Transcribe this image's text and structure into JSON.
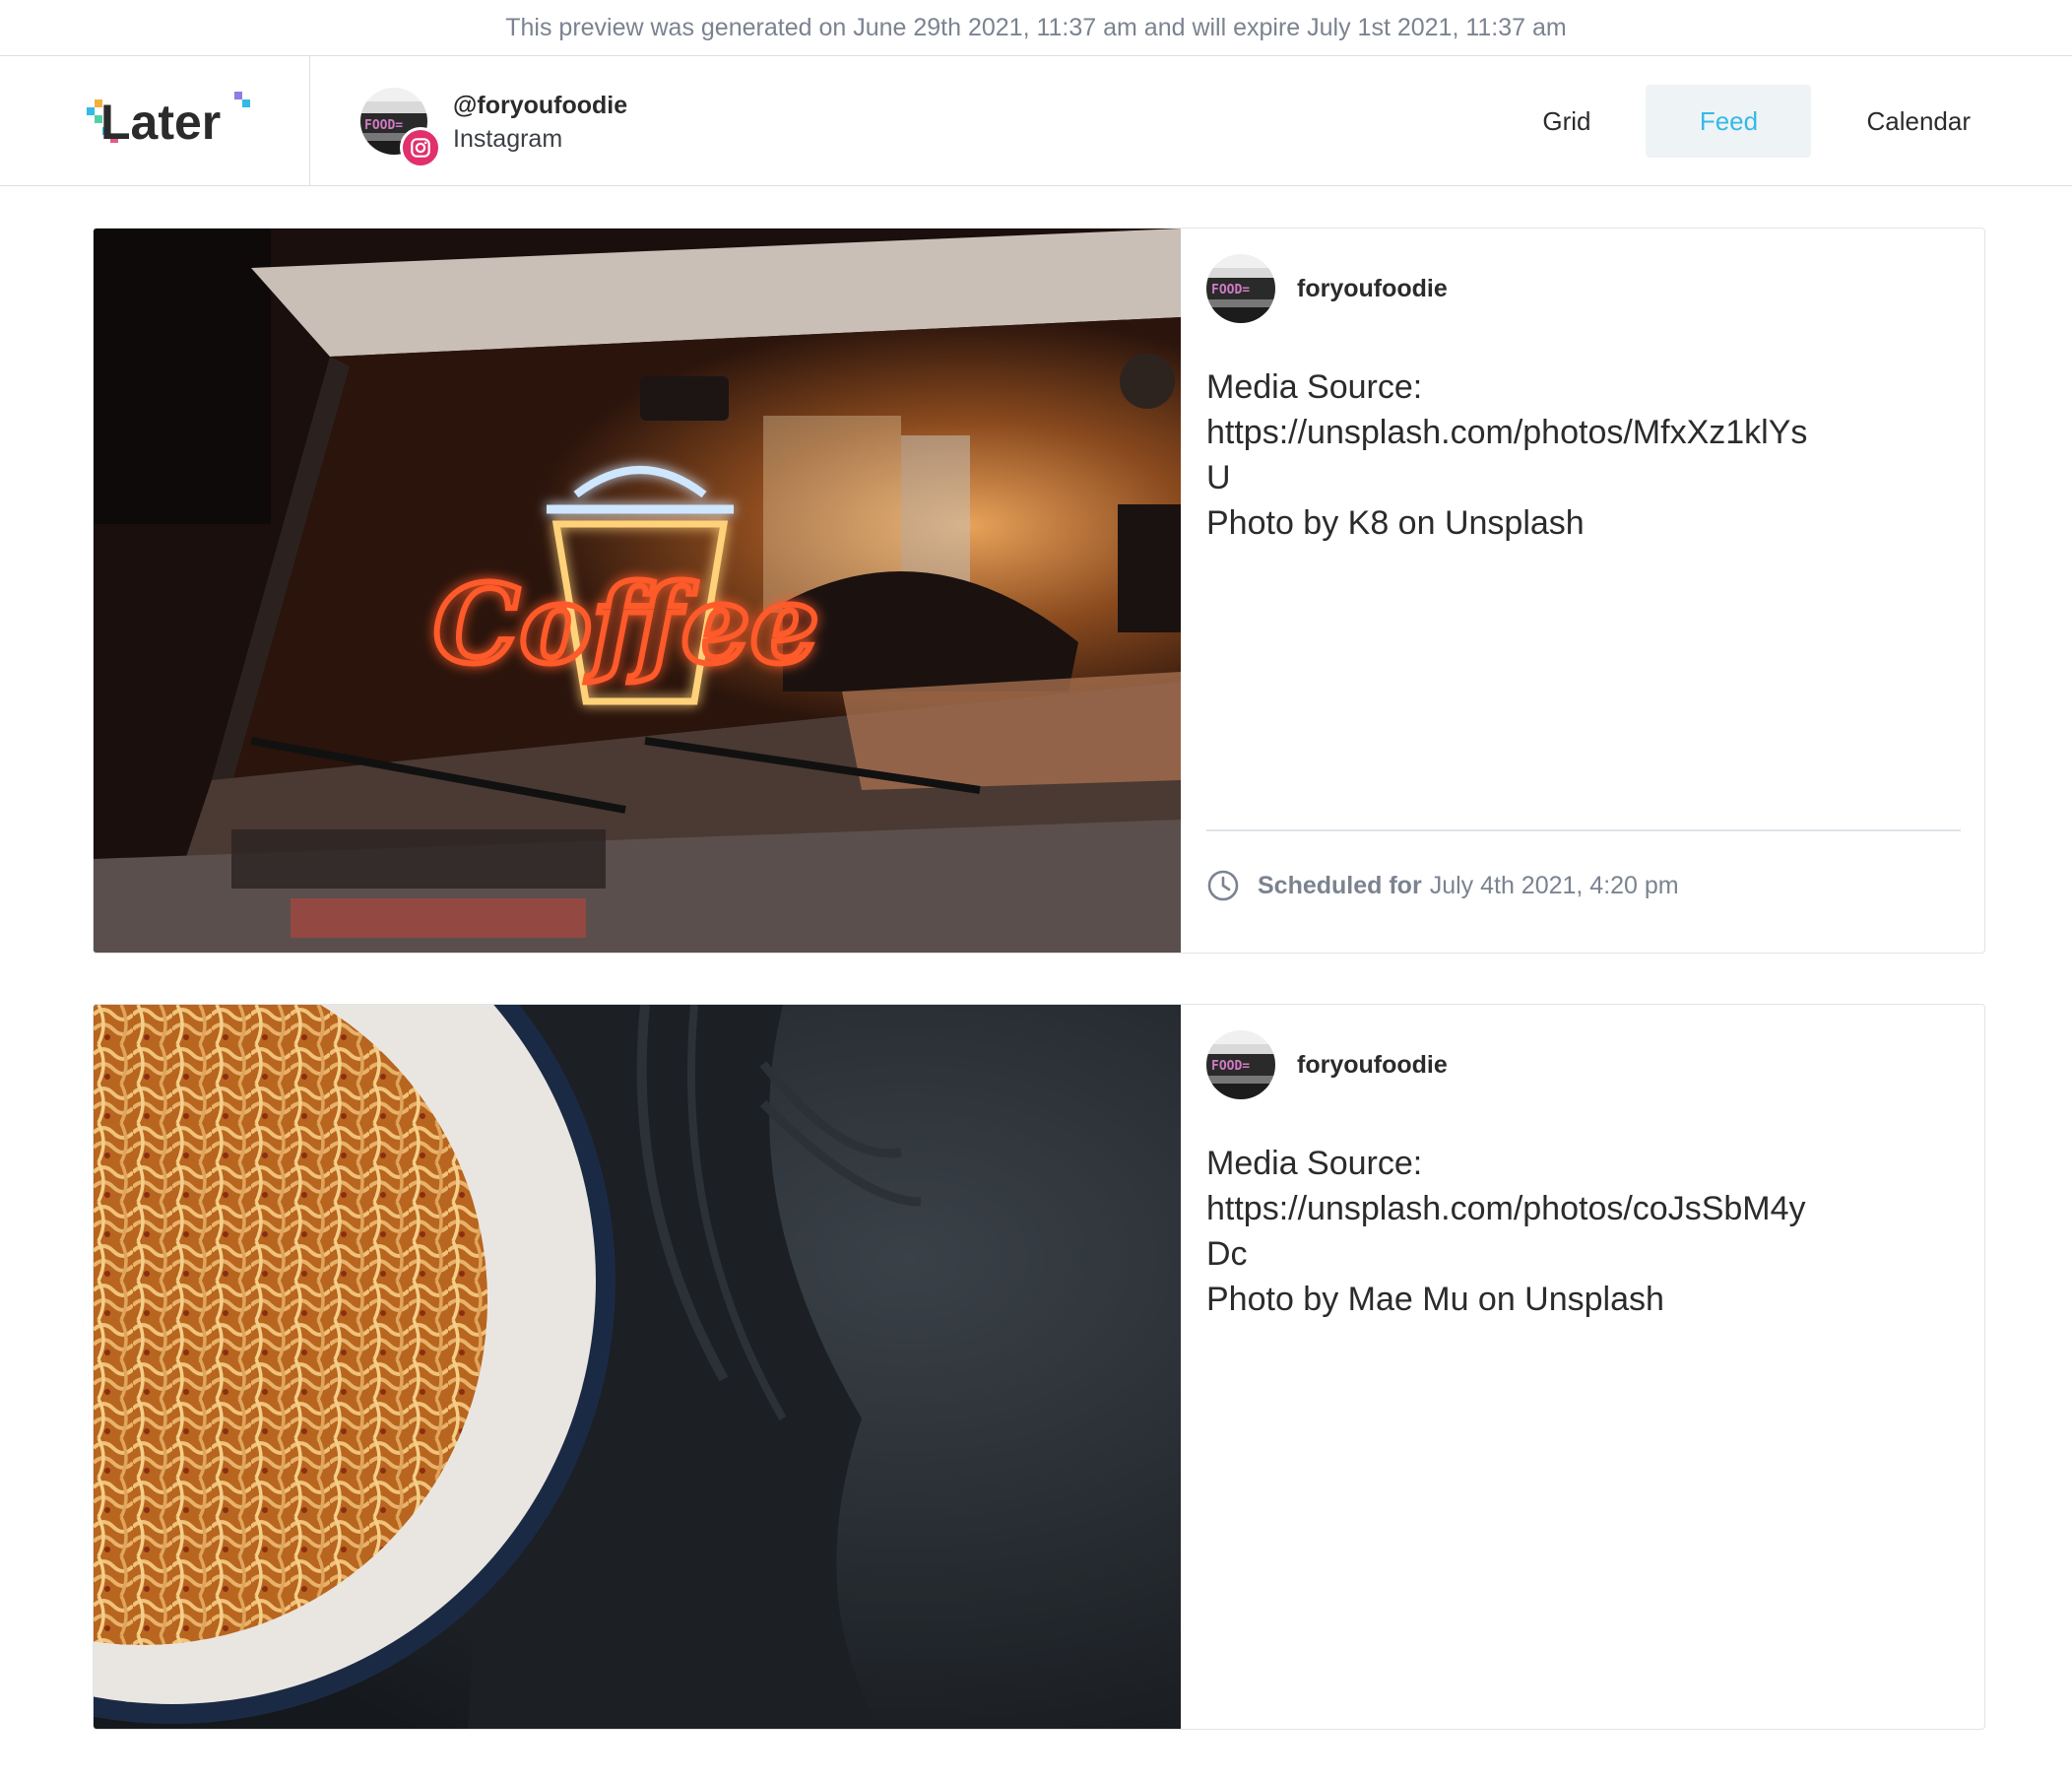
{
  "banner": {
    "text": "This preview was generated on June 29th 2021, 11:37 am and will expire July 1st 2021, 11:37 am"
  },
  "header": {
    "logo_text": "Later",
    "profile": {
      "handle": "@foryoufoodie",
      "network": "Instagram",
      "avatar_text": "FOOD="
    },
    "nav": [
      {
        "label": "Grid",
        "active": false
      },
      {
        "label": "Feed",
        "active": true
      },
      {
        "label": "Calendar",
        "active": false
      }
    ]
  },
  "colors": {
    "accent": "#35b9e6",
    "instagram": "#e1306c",
    "muted": "#7b8390"
  },
  "posts": [
    {
      "author": "foryoufoodie",
      "avatar_text": "FOOD=",
      "caption_lines": [
        "Media Source:",
        "https://unsplash.com/photos/MfxXz1klYs",
        "U",
        "Photo by K8 on Unsplash"
      ],
      "schedule_label": "Scheduled for",
      "schedule_time": "July 4th 2021, 4:20 pm",
      "media_sign_text": "Coffee"
    },
    {
      "author": "foryoufoodie",
      "avatar_text": "FOOD=",
      "caption_lines": [
        "Media Source:",
        "https://unsplash.com/photos/coJsSbM4y",
        "Dc",
        "Photo by Mae Mu on Unsplash"
      ]
    }
  ]
}
